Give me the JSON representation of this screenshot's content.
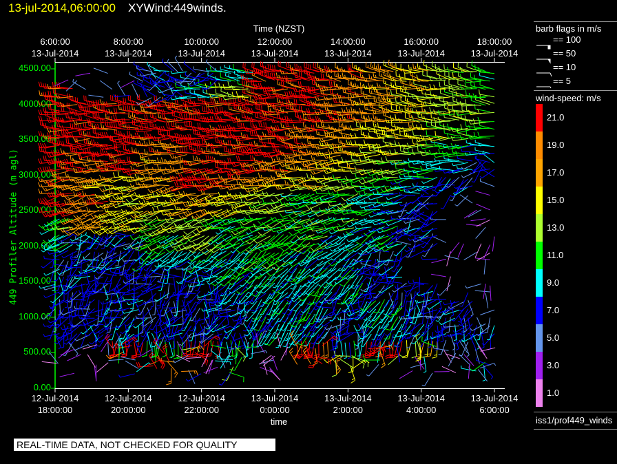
{
  "header": {
    "date": "13-jul-2014,06:00:00",
    "name": "XYWind:449winds."
  },
  "banner": "REAL-TIME DATA, NOT CHECKED FOR QUALITY",
  "legend": {
    "flags_title": "barb flags in m/s",
    "flags": [
      {
        "label": "== 100",
        "value": 100
      },
      {
        "label": "== 50",
        "value": 50
      },
      {
        "label": "== 10",
        "value": 10
      },
      {
        "label": "== 5",
        "value": 5
      }
    ],
    "speed_title": "wind-speed: m/s",
    "source": "iss1/prof449_winds"
  },
  "chart_data": {
    "type": "wind-barb",
    "top_axis_title": "Time (NZST)",
    "xlabel": "time",
    "ylabel": "449 Profiler Altitude (m agl)",
    "ylim": [
      0,
      4500
    ],
    "y_ticks": [
      "0.00",
      "500.00",
      "1000.00",
      "1500.00",
      "2000.00",
      "2500.00",
      "3000.00",
      "3500.00",
      "4000.00",
      "4500.00"
    ],
    "bottom_ticks": [
      {
        "date": "12-Jul-2014",
        "time": "18:00:00"
      },
      {
        "date": "12-Jul-2014",
        "time": "20:00:00"
      },
      {
        "date": "12-Jul-2014",
        "time": "22:00:00"
      },
      {
        "date": "13-Jul-2014",
        "time": "0:00:00"
      },
      {
        "date": "13-Jul-2014",
        "time": "2:00:00"
      },
      {
        "date": "13-Jul-2014",
        "time": "4:00:00"
      },
      {
        "date": "13-Jul-2014",
        "time": "6:00:00"
      }
    ],
    "top_ticks": [
      {
        "time": "6:00:00",
        "date": "13-Jul-2014"
      },
      {
        "time": "8:00:00",
        "date": "13-Jul-2014"
      },
      {
        "time": "10:00:00",
        "date": "13-Jul-2014"
      },
      {
        "time": "12:00:00",
        "date": "13-Jul-2014"
      },
      {
        "time": "14:00:00",
        "date": "13-Jul-2014"
      },
      {
        "time": "16:00:00",
        "date": "13-Jul-2014"
      },
      {
        "time": "18:00:00",
        "date": "13-Jul-2014"
      }
    ],
    "color_scale": [
      {
        "label": "21.0",
        "value": 21,
        "color": "#ff0000"
      },
      {
        "label": "19.0",
        "value": 19,
        "color": "#ff8c00"
      },
      {
        "label": "17.0",
        "value": 17,
        "color": "#ffa500"
      },
      {
        "label": "15.0",
        "value": 15,
        "color": "#ffff00"
      },
      {
        "label": "13.0",
        "value": 13,
        "color": "#adff2f"
      },
      {
        "label": "11.0",
        "value": 11,
        "color": "#00ff00"
      },
      {
        "label": "9.0",
        "value": 9,
        "color": "#00ffff"
      },
      {
        "label": "7.0",
        "value": 7,
        "color": "#0000ff"
      },
      {
        "label": "5.0",
        "value": 5,
        "color": "#6495ed"
      },
      {
        "label": "3.0",
        "value": 3,
        "color": "#a020f0"
      },
      {
        "label": "1.0",
        "value": 1,
        "color": "#ee82ee"
      }
    ],
    "time_hours_from_start": [
      0,
      1,
      2,
      3,
      4,
      5,
      6,
      7,
      8,
      9,
      10,
      11,
      12
    ],
    "altitudes_m": [
      4500,
      4250,
      4000,
      3750,
      3500,
      3250,
      3000,
      2750,
      2500,
      2250,
      2000,
      1750,
      1500,
      1250,
      1000,
      750,
      500,
      250
    ],
    "direction_deg": [
      280,
      280,
      275,
      275,
      270,
      270,
      265,
      260,
      255,
      250,
      240,
      230,
      225,
      220,
      215,
      210,
      180,
      180
    ],
    "speed_ms": [
      [
        3,
        3,
        5,
        5,
        7,
        7,
        21,
        21,
        19,
        17,
        15,
        13,
        13
      ],
      [
        3,
        5,
        5,
        7,
        7,
        9,
        21,
        21,
        19,
        17,
        15,
        13,
        11
      ],
      [
        21,
        5,
        5,
        7,
        9,
        13,
        21,
        21,
        19,
        17,
        15,
        13,
        11
      ],
      [
        21,
        21,
        21,
        21,
        21,
        21,
        21,
        21,
        19,
        17,
        15,
        13,
        13
      ],
      [
        21,
        21,
        21,
        21,
        21,
        21,
        21,
        19,
        17,
        15,
        15,
        13,
        11
      ],
      [
        21,
        21,
        21,
        19,
        21,
        21,
        21,
        19,
        17,
        15,
        13,
        11,
        9
      ],
      [
        21,
        19,
        21,
        17,
        19,
        21,
        19,
        17,
        15,
        13,
        11,
        9,
        7
      ],
      [
        19,
        17,
        15,
        17,
        21,
        19,
        17,
        15,
        13,
        11,
        9,
        7,
        5
      ],
      [
        21,
        19,
        15,
        15,
        17,
        15,
        13,
        11,
        11,
        9,
        7,
        5,
        3
      ],
      [
        11,
        17,
        15,
        13,
        13,
        11,
        11,
        11,
        11,
        9,
        7,
        5,
        3
      ],
      [
        9,
        7,
        7,
        11,
        13,
        11,
        11,
        11,
        9,
        9,
        7,
        5,
        3
      ],
      [
        7,
        7,
        7,
        9,
        9,
        9,
        11,
        9,
        9,
        7,
        5,
        3,
        3
      ],
      [
        7,
        7,
        7,
        7,
        7,
        9,
        9,
        9,
        9,
        7,
        5,
        3,
        3
      ],
      [
        7,
        7,
        7,
        7,
        7,
        9,
        9,
        9,
        9,
        7,
        7,
        5,
        5
      ],
      [
        7,
        7,
        7,
        7,
        7,
        7,
        9,
        9,
        7,
        9,
        7,
        7,
        5
      ],
      [
        7,
        7,
        7,
        7,
        7,
        7,
        9,
        9,
        7,
        9,
        7,
        7,
        7
      ],
      [
        5,
        3,
        21,
        11,
        21,
        9,
        3,
        21,
        9,
        21,
        15,
        5,
        3
      ],
      [
        5,
        3,
        7,
        21,
        5,
        9,
        3,
        21,
        15,
        9,
        5,
        3,
        7
      ]
    ]
  }
}
